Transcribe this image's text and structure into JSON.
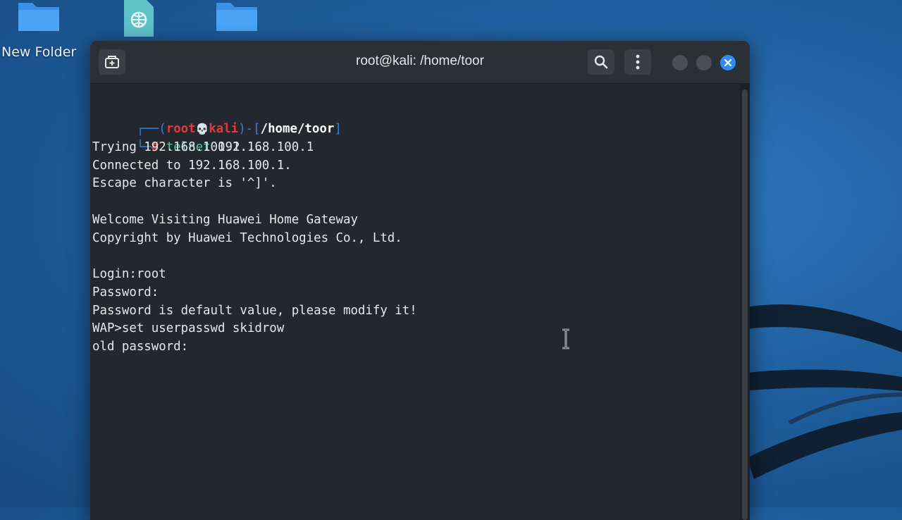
{
  "desktop": {
    "icons": [
      {
        "label": "New Folder",
        "icon": "folder-icon"
      },
      {
        "label": "",
        "icon": "web-file-icon"
      },
      {
        "label": "",
        "icon": "folder-icon"
      }
    ]
  },
  "window": {
    "title": "root@kali: /home/toor",
    "buttons": {
      "new_tab": "new-tab-icon",
      "search": "search-icon",
      "menu": "kebab-menu-icon",
      "minimize": "minimize",
      "maximize": "maximize",
      "close": "close-icon"
    },
    "accent_color": "#2f8cf0"
  },
  "terminal": {
    "prompt": {
      "open": "┌──(",
      "user": "root",
      "skull": "💀",
      "host": "kali",
      "mid": ")-[",
      "path": "/home/toor",
      "close": "]",
      "branch": "└─",
      "hash": "#",
      "command": "telnet",
      "args": " 192.168.100.1"
    },
    "lines": [
      "Trying 192.168.100.1...",
      "Connected to 192.168.100.1.",
      "Escape character is '^]'.",
      "",
      "Welcome Visiting Huawei Home Gateway",
      "Copyright by Huawei Technologies Co., Ltd.",
      "",
      "Login:root",
      "Password:",
      "Password is default value, please modify it!",
      "WAP>set userpasswd skidrow",
      "old password:"
    ]
  }
}
